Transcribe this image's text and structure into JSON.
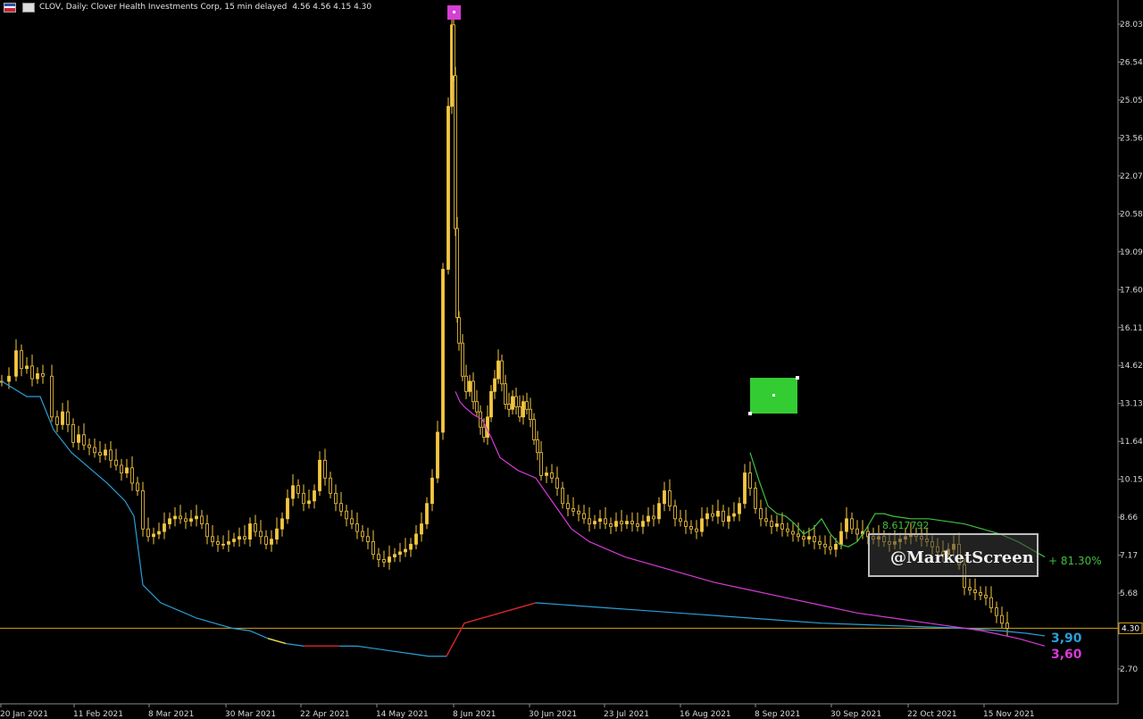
{
  "header": {
    "title": "CLOV, Daily:  Clover Health Investments Corp, 15 min delayed",
    "quote": "4.56 4.56 4.15 4.30"
  },
  "colors": {
    "background": "#000000",
    "candle": "#f5c842",
    "ma_blue": "#2a9fd6",
    "ma_magenta": "#d63ad6",
    "ma_red": "#d62020",
    "ma_yellow": "#f0e040",
    "trend_green": "#3fbf3f",
    "price_line": "#d4a017"
  },
  "chart_data": {
    "type": "line",
    "title": "CLOV, Daily",
    "ylim": [
      1.8,
      29.4
    ],
    "y_ticks": [
      "28.03",
      "26.54",
      "25.05",
      "23.56",
      "22.07",
      "20.58",
      "19.09",
      "17.60",
      "16.11",
      "14.62",
      "13.13",
      "11.64",
      "10.15",
      "8.66",
      "7.17",
      "5.68",
      "4.30",
      "2.70"
    ],
    "x_ticks": [
      "20 Jan 2021",
      "11 Feb 2021",
      "8 Mar 2021",
      "30 Mar 2021",
      "22 Apr 2021",
      "14 May 2021",
      "8 Jun 2021",
      "30 Jun 2021",
      "23 Jul 2021",
      "16 Aug 2021",
      "8 Sep 2021",
      "30 Sep 2021",
      "22 Oct 2021",
      "15 Nov 2021"
    ],
    "last_price": 4.3,
    "last_price_label": "4.30",
    "candles": {
      "x": [
        2,
        10,
        18,
        24,
        30,
        36,
        42,
        48,
        58,
        64,
        70,
        76,
        82,
        88,
        94,
        100,
        106,
        112,
        118,
        124,
        130,
        136,
        142,
        148,
        154,
        160,
        166,
        172,
        178,
        184,
        190,
        196,
        202,
        208,
        214,
        220,
        226,
        232,
        238,
        244,
        250,
        256,
        262,
        268,
        274,
        280,
        286,
        292,
        298,
        304,
        310,
        316,
        322,
        328,
        334,
        340,
        346,
        352,
        358,
        364,
        370,
        376,
        382,
        388,
        394,
        400,
        406,
        412,
        418,
        424,
        430,
        436,
        442,
        448,
        454,
        460,
        466,
        472,
        478,
        484,
        490,
        496,
        502,
        506,
        508,
        510,
        512,
        514,
        518,
        522,
        526,
        530,
        534,
        538,
        542,
        546,
        550,
        554,
        558,
        562,
        566,
        570,
        574,
        578,
        582,
        586,
        590,
        594,
        598,
        602,
        606,
        612,
        618,
        624,
        630,
        636,
        642,
        648,
        654,
        660,
        666,
        672,
        678,
        684,
        690,
        696,
        702,
        708,
        714,
        720,
        726,
        732,
        738,
        744,
        750,
        756,
        762,
        768,
        774,
        780,
        786,
        792,
        798,
        804,
        810,
        816,
        822,
        828,
        834,
        840,
        846,
        852,
        858,
        864,
        870,
        876,
        882,
        888,
        894,
        900,
        906,
        912,
        918,
        924,
        930,
        936,
        942,
        948,
        954,
        960,
        966,
        972,
        978,
        984,
        990,
        996,
        1002,
        1008,
        1014,
        1020,
        1026,
        1032,
        1038,
        1044,
        1050,
        1056,
        1062,
        1068,
        1074,
        1080,
        1086,
        1092,
        1098,
        1104,
        1110,
        1116,
        1122,
        1128,
        1134,
        1140,
        1146,
        1152,
        1158,
        1164,
        1170
      ],
      "close": [
        14.0,
        14.2,
        15.2,
        14.5,
        14.6,
        14.1,
        14.3,
        14.2,
        12.6,
        12.3,
        12.8,
        12.3,
        11.6,
        11.9,
        11.5,
        11.4,
        11.2,
        11.1,
        11.3,
        10.9,
        10.7,
        10.4,
        10.6,
        10.0,
        9.7,
        8.2,
        7.9,
        8.0,
        8.1,
        8.4,
        8.6,
        8.7,
        8.6,
        8.5,
        8.6,
        8.7,
        8.4,
        7.9,
        7.7,
        7.6,
        7.6,
        7.7,
        7.8,
        7.9,
        7.8,
        8.4,
        8.1,
        7.9,
        7.6,
        7.8,
        8.2,
        8.6,
        9.4,
        9.9,
        9.6,
        9.2,
        9.3,
        9.7,
        10.9,
        10.2,
        9.6,
        9.2,
        8.9,
        8.6,
        8.4,
        8.1,
        7.9,
        7.7,
        7.2,
        7.0,
        6.9,
        7.1,
        7.2,
        7.3,
        7.4,
        7.6,
        8.0,
        8.4,
        9.2,
        10.2,
        12.0,
        18.4,
        24.8,
        28.0,
        26.0,
        20.0,
        16.5,
        15.5,
        14.2,
        13.6,
        14.0,
        13.2,
        12.8,
        12.2,
        11.8,
        12.6,
        13.6,
        14.1,
        14.8,
        13.9,
        13.1,
        12.9,
        13.4,
        13.0,
        12.6,
        13.2,
        12.9,
        12.5,
        11.7,
        11.2,
        10.3,
        10.4,
        10.2,
        9.8,
        9.2,
        9.0,
        8.9,
        8.8,
        8.6,
        8.4,
        8.5,
        8.6,
        8.4,
        8.3,
        8.5,
        8.4,
        8.5,
        8.4,
        8.3,
        8.5,
        8.7,
        8.6,
        9.2,
        9.7,
        9.1,
        8.6,
        8.5,
        8.3,
        8.2,
        8.1,
        8.6,
        8.8,
        8.7,
        8.9,
        8.5,
        8.7,
        8.8,
        9.2,
        10.4,
        9.8,
        9.0,
        8.6,
        8.5,
        8.3,
        8.4,
        8.2,
        8.1,
        8.0,
        7.9,
        7.8,
        7.9,
        7.7,
        7.6,
        7.5,
        7.4,
        7.6,
        8.1,
        8.6,
        8.2,
        8.0,
        8.1,
        7.9,
        7.8,
        7.9,
        7.7,
        7.6,
        7.7,
        7.8,
        7.9,
        8.0,
        7.9,
        7.8,
        7.7,
        7.5,
        7.3,
        7.2,
        7.4,
        7.6,
        6.8,
        5.9,
        5.8,
        5.7,
        5.6,
        5.5,
        5.1,
        4.8,
        4.5,
        4.3
      ]
    },
    "series": [
      {
        "name": "",
        "color": "#2a9fd6",
        "x": [
          2,
          30,
          45,
          60,
          80,
          100,
          120,
          140,
          150,
          160,
          180,
          200,
          220,
          240,
          260,
          280,
          300,
          320,
          340,
          360,
          380,
          400,
          420,
          440,
          460,
          480,
          500,
          520,
          560,
          600,
          640,
          680,
          720,
          760,
          800,
          840,
          880,
          920,
          960,
          1000,
          1040,
          1080,
          1120,
          1150,
          1170
        ],
        "y": [
          14.0,
          13.4,
          13.4,
          12.1,
          11.2,
          10.6,
          10.0,
          9.3,
          8.7,
          6.0,
          5.3,
          5.0,
          4.7,
          4.5,
          4.3,
          4.2,
          3.9,
          3.7,
          3.6,
          3.6,
          3.6,
          3.6,
          3.5,
          3.4,
          3.3,
          3.2,
          3.2,
          4.5,
          4.9,
          5.3,
          5.2,
          5.1,
          5.0,
          4.9,
          4.8,
          4.7,
          4.6,
          4.5,
          4.45,
          4.4,
          4.35,
          4.3,
          4.2,
          4.1,
          4.0
        ]
      },
      {
        "name": "",
        "color": "#d63ad6",
        "x": [
          510,
          515,
          520,
          530,
          540,
          550,
          560,
          580,
          600,
          620,
          640,
          660,
          680,
          700,
          720,
          760,
          800,
          840,
          880,
          920,
          960,
          1000,
          1040,
          1080,
          1100,
          1120,
          1140,
          1170
        ],
        "y": [
          13.6,
          13.2,
          13.0,
          12.7,
          12.5,
          11.8,
          11.0,
          10.5,
          10.2,
          9.2,
          8.2,
          7.7,
          7.4,
          7.1,
          6.9,
          6.5,
          6.1,
          5.8,
          5.5,
          5.2,
          4.9,
          4.7,
          4.5,
          4.3,
          4.2,
          4.05,
          3.9,
          3.6
        ]
      },
      {
        "name": "",
        "color": "#3fbf3f",
        "x": [
          840,
          850,
          860,
          870,
          880,
          890,
          900,
          910,
          920,
          930,
          940,
          950,
          960,
          970,
          980,
          990,
          1000,
          1020,
          1040,
          1060,
          1080,
          1100,
          1120,
          1140,
          1160,
          1170
        ],
        "y": [
          11.2,
          10.1,
          9.1,
          8.8,
          8.7,
          8.4,
          8.0,
          8.2,
          8.6,
          8.0,
          7.6,
          7.5,
          7.7,
          8.2,
          8.8,
          8.8,
          8.7,
          8.6,
          8.6,
          8.5,
          8.4,
          8.2,
          8.0,
          7.7,
          7.3,
          7.1
        ]
      }
    ],
    "labels": {
      "trend_value": "8.617792",
      "trend_pct": "+ 81.30%",
      "ma_blue_value": "3,90",
      "ma_magenta_value": "3,60",
      "watermark": "@MarketScreen"
    }
  }
}
